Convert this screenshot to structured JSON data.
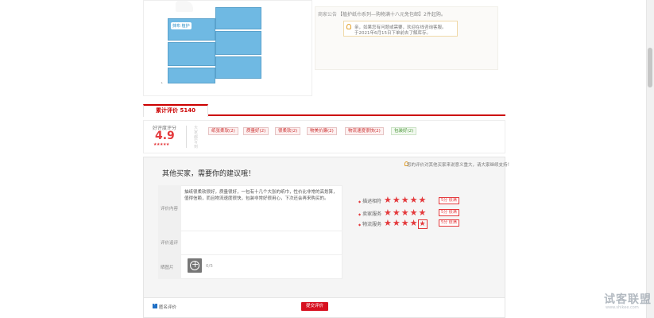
{
  "product": {
    "pack_label": "抹布 植护"
  },
  "announcement": {
    "label": "商家公告",
    "text": "【植护纸巾系列—购物满十八元免包邮】2件起购。",
    "lines": [
      "亲，如果您有问题或需要，欢迎在线咨询客服。",
      "于2021年6月15日下单前去了解库存。"
    ]
  },
  "tabs": {
    "active_label": "累计评价 5140"
  },
  "summary": {
    "good_rate_label": "好评度评分",
    "score": "4.9",
    "stars": "★★★★★",
    "vertical_caption": "大家都写到",
    "tags": [
      {
        "label": "纸张柔软(2)",
        "color": "red"
      },
      {
        "label": "质量好(2)",
        "color": "red"
      },
      {
        "label": "很柔软(2)",
        "color": "red"
      },
      {
        "label": "物美价廉(2)",
        "color": "red"
      },
      {
        "label": "物流速度很快(2)",
        "color": "red"
      },
      {
        "label": "包装好(2)",
        "color": "green"
      }
    ]
  },
  "review_form": {
    "tip": "您的评价对其他买家来说意义重大，请大家继续支持！",
    "title": "其他买家，需要你的建议哦！",
    "labels": {
      "content": "评价内容",
      "append": "评价追评",
      "images": "晒图片"
    },
    "review_text": "抽纸很柔软很好，质量很好，一包有十几个大张的纸巾，性价比非常的高划算，值得信赖，而且物流速度很快，包装非常好很用心，下次还会再来购买的。",
    "upload_count": "0/5",
    "ratings": [
      {
        "label": "描述相符",
        "stars": "★★★★★",
        "score": "5分 很满"
      },
      {
        "label": "卖家服务",
        "stars": "★★★★★",
        "score": "5分 很满"
      },
      {
        "label": "物流服务",
        "stars": "★★★★",
        "last": "★",
        "score": "5分 很满"
      }
    ]
  },
  "bottom": {
    "anonymous_label": "匿名评价",
    "submit_label": "提交评价"
  },
  "watermark": {
    "main": "试客联盟",
    "sub": "www.shikee.com"
  },
  "colors": {
    "accent": "#e4393c",
    "submit": "#d7101f",
    "tag_green": "#4d9a3c"
  }
}
